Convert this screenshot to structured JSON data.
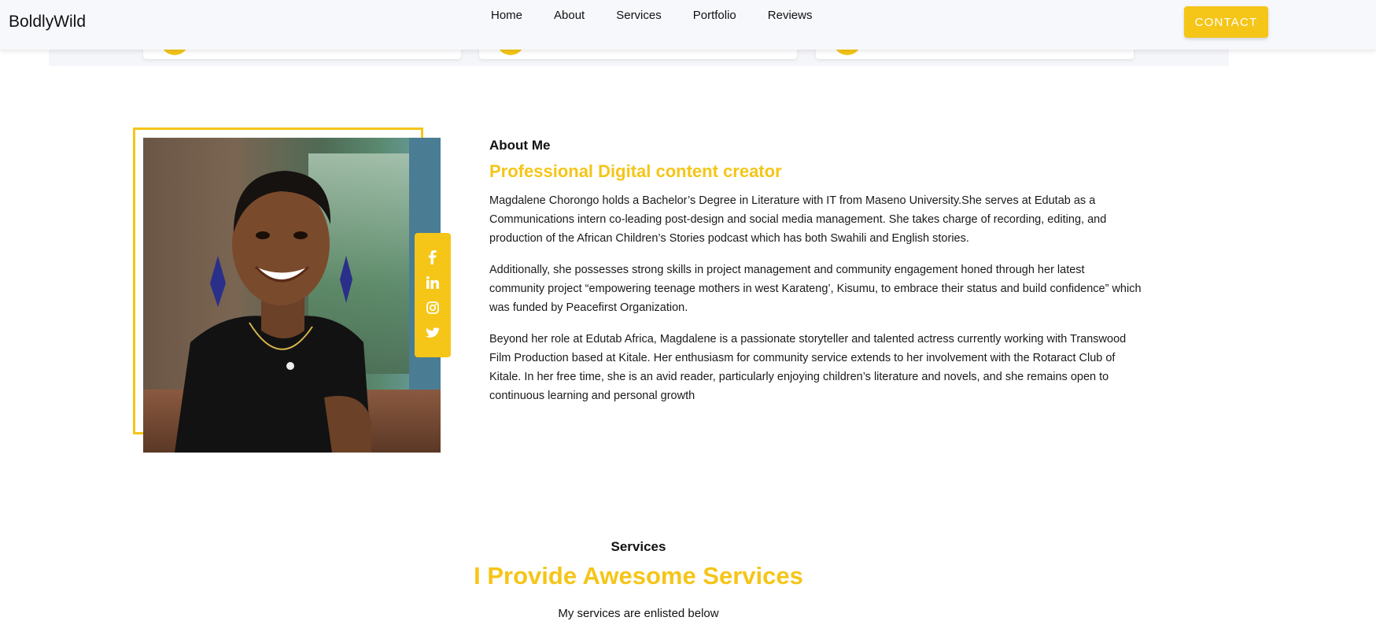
{
  "brand": {
    "name": "BoldlyWild"
  },
  "nav": {
    "links": [
      "Home",
      "About",
      "Services",
      "Portfolio",
      "Reviews"
    ],
    "contact_label": "CONTACT"
  },
  "colors": {
    "accent": "#f5c518",
    "nav_bg": "#f7f8fc",
    "text": "#111111"
  },
  "about": {
    "label": "About Me",
    "title": "Professional Digital content creator",
    "paragraphs": [
      "Magdalene Chorongo holds a Bachelor’s Degree in Literature with IT from Maseno University.She serves at Edutab as a Communications intern co-leading post-design and social media management. She takes charge of recording, editing, and production of the African Children’s Stories podcast which has both Swahili and English stories.",
      "Additionally, she possesses strong skills in project management and community engagement honed through her latest community project “empowering teenage mothers in west Karateng’, Kisumu, to embrace their status and build confidence” which was funded by Peacefirst Organization.",
      "Beyond her role at Edutab Africa, Magdalene is a passionate storyteller and talented actress currently working with Transwood Film Production based at Kitale. Her enthusiasm for community service extends to her involvement with the Rotaract Club of Kitale. In her free time, she is an avid reader, particularly enjoying children’s literature and novels, and she remains open to continuous learning and personal growth"
    ],
    "social_icons": [
      "facebook-icon",
      "linkedin-icon",
      "instagram-icon",
      "twitter-icon"
    ]
  },
  "services": {
    "label": "Services",
    "title": "I Provide Awesome Services",
    "subtitle": "My services are enlisted below"
  }
}
